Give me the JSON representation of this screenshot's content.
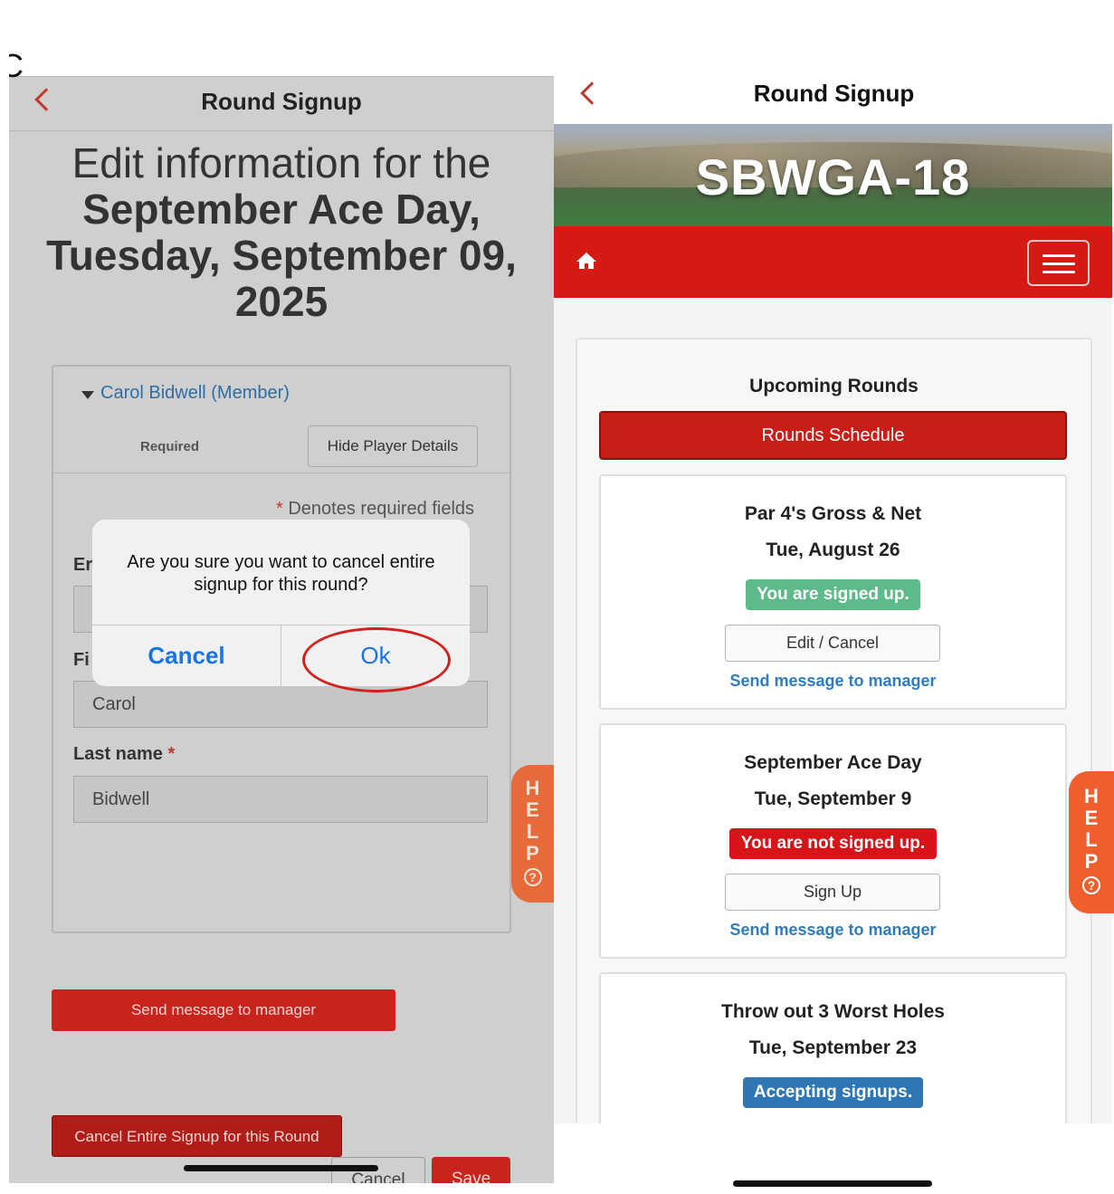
{
  "left": {
    "cut_char": "C",
    "nav_title": "Round Signup",
    "heading_line1": "Edit information for the",
    "heading_bold": "September Ace Day, Tuesday, September 09, 2025",
    "player_name": "Carol Bidwell (Member)",
    "required_label": "Required",
    "hide_details_label": "Hide Player Details",
    "required_note_star": "*",
    "required_note": "Denotes required fields",
    "email_label_partial": "Er",
    "first_label_partial": "Fi",
    "first_value": "Carol",
    "last_label": "Last name",
    "last_star": "*",
    "last_value": "Bidwell",
    "send_message": "Send message to manager",
    "cancel_entire": "Cancel Entire Signup for this Round",
    "cancel": "Cancel",
    "save": "Save",
    "help_letters": [
      "H",
      "E",
      "L",
      "P"
    ],
    "help_q": "?"
  },
  "alert": {
    "message": "Are you sure you want to cancel entire signup for this round?",
    "cancel": "Cancel",
    "ok": "Ok"
  },
  "right": {
    "nav_title": "Round Signup",
    "banner_title": "SBWGA-18",
    "upcoming_title": "Upcoming Rounds",
    "schedule_button": "Rounds Schedule",
    "rounds": [
      {
        "name": "Par 4's Gross & Net",
        "date": "Tue, August 26",
        "status": "You are signed up.",
        "status_color": "#5dbb8a",
        "action": "Edit / Cancel",
        "message": "Send message to manager"
      },
      {
        "name": "September Ace Day",
        "date": "Tue, September 9",
        "status": "You are not signed up.",
        "status_color": "#d7141a",
        "action": "Sign Up",
        "message": "Send message to manager"
      },
      {
        "name": "Throw out 3 Worst Holes",
        "date": "Tue, September 23",
        "status": "Accepting signups.",
        "status_color": "#2f77b4"
      }
    ],
    "help_letters": [
      "H",
      "E",
      "L",
      "P"
    ],
    "help_q": "?"
  },
  "colors": {
    "accent_red": "#d41a12",
    "link_blue": "#2e7bbd",
    "ios_blue": "#1a73e8",
    "help_orange": "#ef5f2e"
  }
}
